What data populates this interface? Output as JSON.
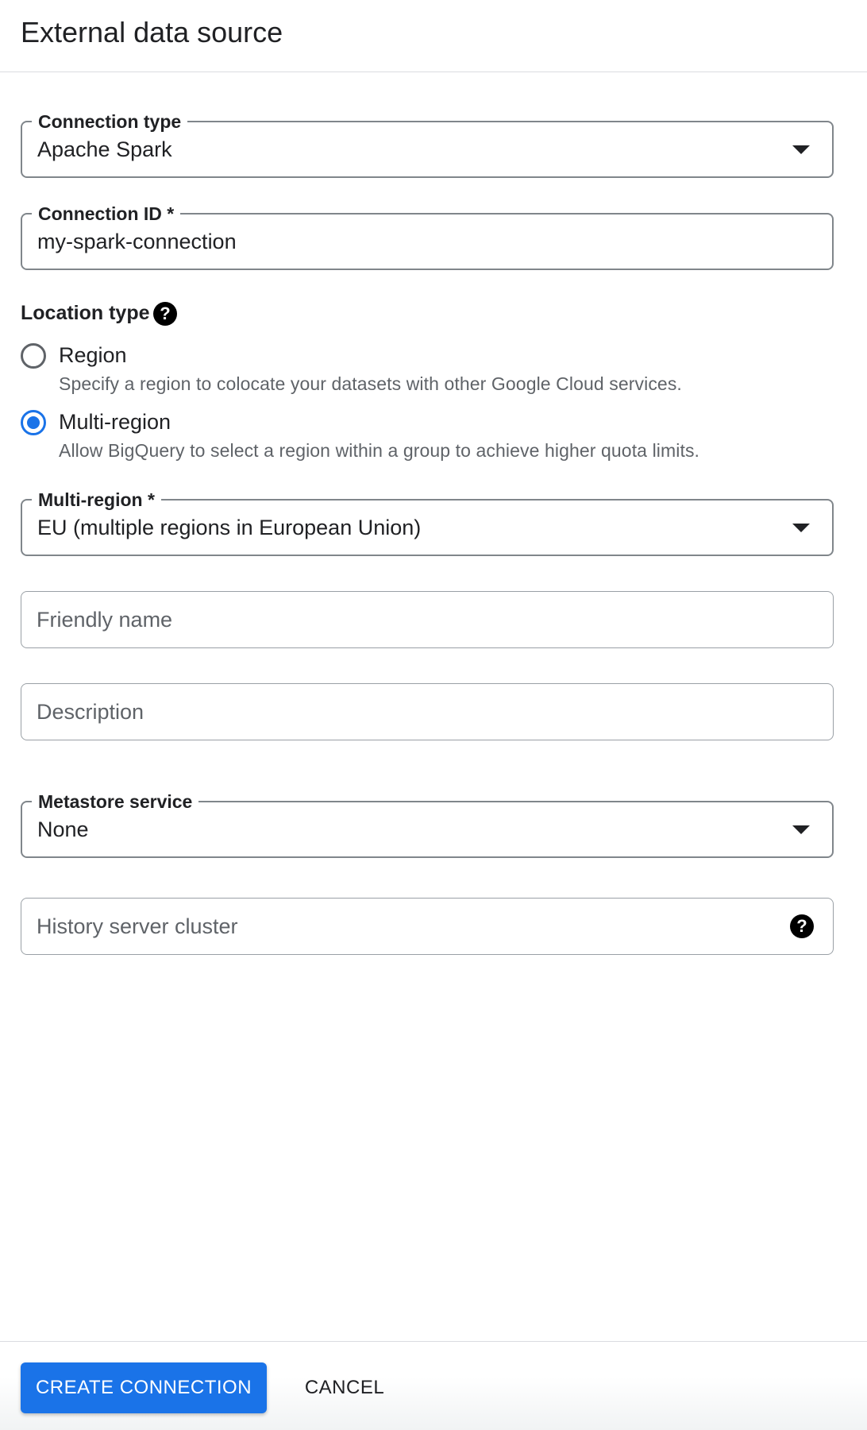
{
  "header": {
    "title": "External data source"
  },
  "connection_type": {
    "label": "Connection type",
    "value": "Apache Spark"
  },
  "connection_id": {
    "label": "Connection ID *",
    "value": "my-spark-connection"
  },
  "location_type": {
    "label": "Location type",
    "help_glyph": "?",
    "options": [
      {
        "label": "Region",
        "description": "Specify a region to colocate your datasets with other Google Cloud services.",
        "selected": false
      },
      {
        "label": "Multi-region",
        "description": "Allow BigQuery to select a region within a group to achieve higher quota limits.",
        "selected": true
      }
    ]
  },
  "multi_region": {
    "label": "Multi-region *",
    "value": "EU (multiple regions in European Union)"
  },
  "friendly_name": {
    "placeholder": "Friendly name"
  },
  "description": {
    "placeholder": "Description"
  },
  "metastore_service": {
    "label": "Metastore service",
    "value": "None"
  },
  "history_server_cluster": {
    "placeholder": "History server cluster",
    "help_glyph": "?"
  },
  "footer": {
    "create_label": "CREATE CONNECTION",
    "cancel_label": "CANCEL"
  },
  "colors": {
    "accent": "#1a73e8",
    "text": "#202124",
    "secondary_text": "#5f6368",
    "border": "#80868b"
  }
}
